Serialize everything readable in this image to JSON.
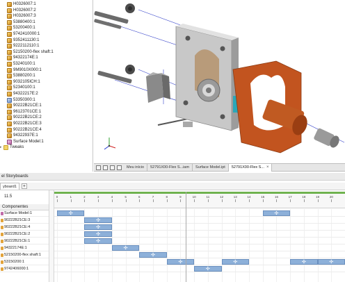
{
  "browser": {
    "items": [
      {
        "label": "H0326007:1",
        "kind": "part"
      },
      {
        "label": "H0326007:2",
        "kind": "part"
      },
      {
        "label": "H0326007:3",
        "kind": "part"
      },
      {
        "label": "53880400:1",
        "kind": "part"
      },
      {
        "label": "53200400:1",
        "kind": "part"
      },
      {
        "label": "9742410000:1",
        "kind": "part"
      },
      {
        "label": "9352411130:1",
        "kind": "part"
      },
      {
        "label": "9222112110:1",
        "kind": "part"
      },
      {
        "label": "52150200-flex shaft:1",
        "kind": "part"
      },
      {
        "label": "94322174E:1",
        "kind": "part"
      },
      {
        "label": "53240100:1",
        "kind": "part"
      },
      {
        "label": "9M9010X000:1",
        "kind": "part"
      },
      {
        "label": "53880200:1",
        "kind": "part"
      },
      {
        "label": "9032105ICH:1",
        "kind": "part"
      },
      {
        "label": "52340100:1",
        "kind": "part"
      },
      {
        "label": "94322217E:2",
        "kind": "part"
      },
      {
        "label": "53350300:1",
        "kind": "asm"
      },
      {
        "label": "90222B21CE:1",
        "kind": "part"
      },
      {
        "label": "96123701CE:1",
        "kind": "part"
      },
      {
        "label": "90222B21CE:2",
        "kind": "part"
      },
      {
        "label": "90222B21CE:3",
        "kind": "part"
      },
      {
        "label": "90222B21CE:4",
        "kind": "part"
      },
      {
        "label": "94322937E:1",
        "kind": "part"
      },
      {
        "label": "Surface Model:1",
        "kind": "surf"
      },
      {
        "label": "Tweaks",
        "kind": "folder"
      }
    ]
  },
  "doc_tabs": {
    "home": "Meu início",
    "tabs": [
      {
        "label": "52791X00-Flex S...iam",
        "active": false
      },
      {
        "label": "Surface Model.ipt",
        "active": false
      },
      {
        "label": "52791X00-Flex S...",
        "active": true
      }
    ],
    "close_glyph": "×"
  },
  "storyboard": {
    "panel_title": "el Storyboards",
    "tab_label": "yboard1",
    "add_glyph": "+",
    "time_value": "11.5",
    "components_header": "Componentes",
    "ruler_labels": [
      "0",
      "1",
      "2",
      "3",
      "4",
      "5",
      "6",
      "7",
      "8",
      "9",
      "10",
      "11",
      "12",
      "13",
      "14",
      "15",
      "16",
      "17",
      "18",
      "19",
      "20",
      "21"
    ],
    "rows": [
      {
        "label": "Surface Model:1",
        "surface": true
      },
      {
        "label": "90222B21CE:3"
      },
      {
        "label": "90222B21CE:4"
      },
      {
        "label": "90222B21CE:2"
      },
      {
        "label": "90222B21CE:1"
      },
      {
        "label": "94322174E:1"
      },
      {
        "label": "52150200-flex shaft:1"
      },
      {
        "label": "53150200:1"
      },
      {
        "label": "9742406000:1"
      }
    ],
    "actions": [
      {
        "row": 0,
        "start": 0,
        "end": 2
      },
      {
        "row": 0,
        "start": 15,
        "end": 17
      },
      {
        "row": 1,
        "start": 2,
        "end": 4
      },
      {
        "row": 2,
        "start": 2,
        "end": 4
      },
      {
        "row": 3,
        "start": 2,
        "end": 4
      },
      {
        "row": 4,
        "start": 2,
        "end": 4
      },
      {
        "row": 5,
        "start": 4,
        "end": 6
      },
      {
        "row": 6,
        "start": 6,
        "end": 8
      },
      {
        "row": 7,
        "start": 8,
        "end": 10
      },
      {
        "row": 7,
        "start": 12,
        "end": 14
      },
      {
        "row": 7,
        "start": 17,
        "end": 19
      },
      {
        "row": 7,
        "start": 19,
        "end": 21
      },
      {
        "row": 8,
        "start": 10,
        "end": 12
      }
    ],
    "playhead_time": 9.4
  },
  "colors": {
    "action_bar": "#8db0d9",
    "timeline_green": "#6fb24f",
    "copper_part": "#c2541f",
    "cyan_part": "#2ba7b8"
  }
}
